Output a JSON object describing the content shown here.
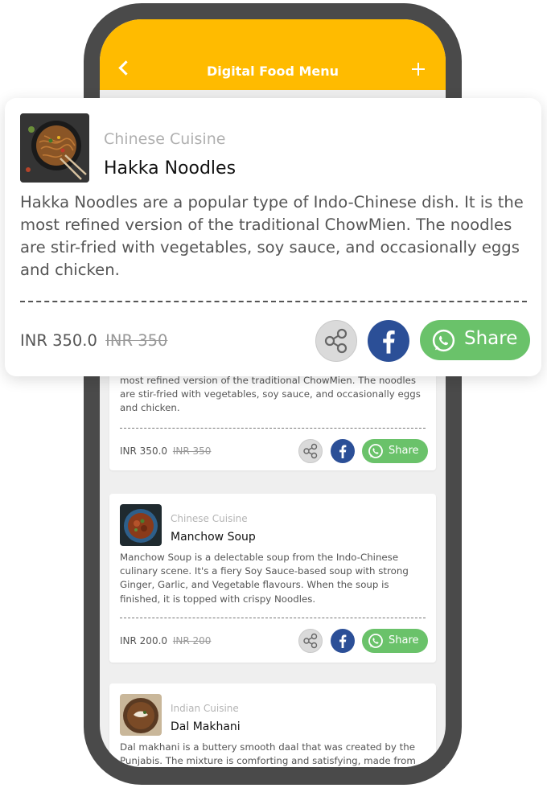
{
  "appbar": {
    "title": "Digital Food Menu"
  },
  "colors": {
    "accent": "#ffbb00",
    "facebook": "#2b4f97",
    "whatsapp": "#6ac26a"
  },
  "featured": {
    "cuisine": "Chinese Cuisine",
    "name": "Hakka Noodles",
    "description": "Hakka Noodles are a popular type of Indo-Chinese dish. It is the most refined version of the traditional ChowMien. The noodles are stir-fried with vegetables, soy sauce, and occasionally eggs and chicken.",
    "price": "INR 350.0",
    "old_price": "INR 350",
    "share_label": "Share"
  },
  "items": [
    {
      "cuisine": "Chinese Cuisine",
      "name": "Hakka Noodles",
      "description": "most refined version of the traditional ChowMien. The noodles are stir-fried with vegetables, soy sauce, and occasionally eggs and chicken.",
      "price": "INR 350.0",
      "old_price": "INR 350",
      "share_label": "Share"
    },
    {
      "cuisine": "Chinese Cuisine",
      "name": "Manchow Soup",
      "description": "Manchow Soup is a delectable soup from the Indo-Chinese culinary scene. It's a fiery Soy Sauce-based soup with strong Ginger, Garlic, and Vegetable flavours. When the soup is finished, it is topped with crispy Noodles.",
      "price": "INR 200.0",
      "old_price": "INR 200",
      "share_label": "Share"
    },
    {
      "cuisine": "Indian Cuisine",
      "name": "Dal Makhani",
      "description": "Dal makhani is a buttery smooth daal that was created by the Punjabis. The mixture is comforting and satisfying, made from"
    }
  ]
}
